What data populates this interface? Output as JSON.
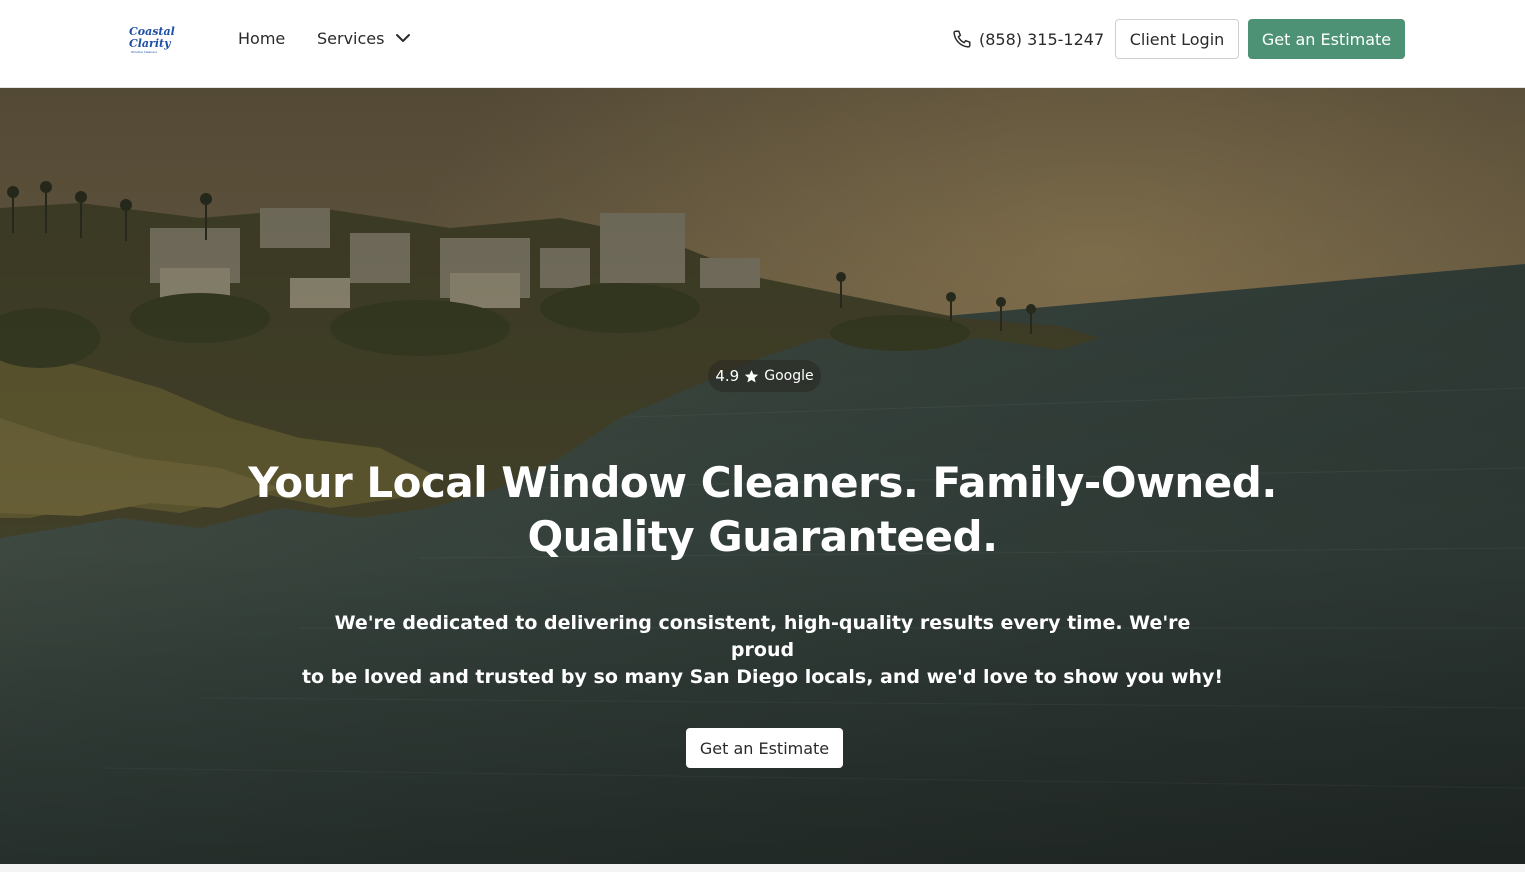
{
  "header": {
    "logo": {
      "line1": "Coastal",
      "line2": "Clarity",
      "line3": "Window Cleaners",
      "color": "#1d4fa3"
    },
    "nav": {
      "home_label": "Home",
      "services_label": "Services",
      "services_icon": "chevron-down-icon"
    },
    "phone": {
      "icon": "phone-icon",
      "number": "(858) 315-1247"
    },
    "client_login_label": "Client Login",
    "estimate_label": "Get an Estimate"
  },
  "hero": {
    "rating": {
      "score": "4.9",
      "icon": "star-icon",
      "source": "Google"
    },
    "headline_line1": "Your Local Window Cleaners. Family-Owned.",
    "headline_line2": "Quality Guaranteed.",
    "subtext_line1": "We're dedicated to delivering consistent, high-quality results every time. We're proud",
    "subtext_line2": "to be loved and trusted by so many San Diego locals, and we'd love to show you why!",
    "cta_label": "Get an Estimate"
  },
  "colors": {
    "accent_green": "#4e9275",
    "logo_blue": "#1d4fa3",
    "header_bg": "#ffffff",
    "text_dark": "#2a2a2a"
  }
}
